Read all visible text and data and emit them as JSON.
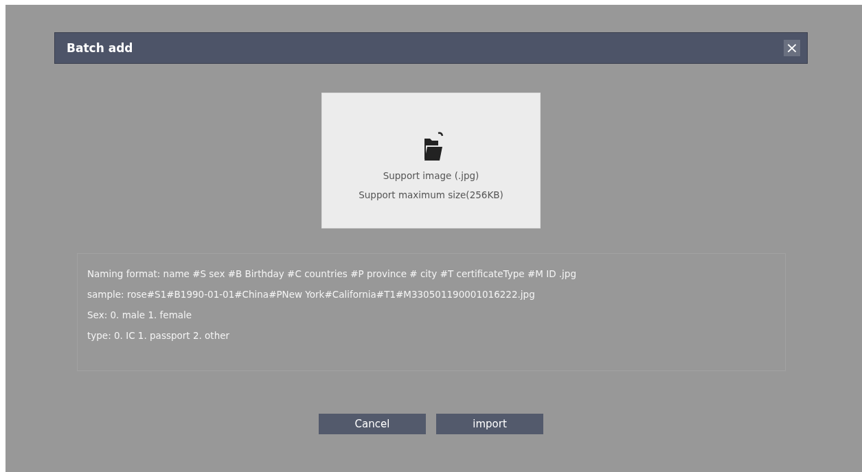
{
  "dialog": {
    "title": "Batch add",
    "close": "×"
  },
  "upload": {
    "lines": [
      "Support image (.jpg)",
      "Support maximum size(256KB)"
    ]
  },
  "info": [
    "Naming format:  name #S sex #B Birthday #C countries #P province # city #T certificateType #M ID .jpg",
    "sample:  rose#S1#B1990-01-01#China#PNew York#California#T1#M330501190001016222.jpg",
    "Sex:  0. male 1. female",
    "type:  0. IC 1. passport 2. other"
  ],
  "buttons": [
    "Cancel",
    "import"
  ]
}
